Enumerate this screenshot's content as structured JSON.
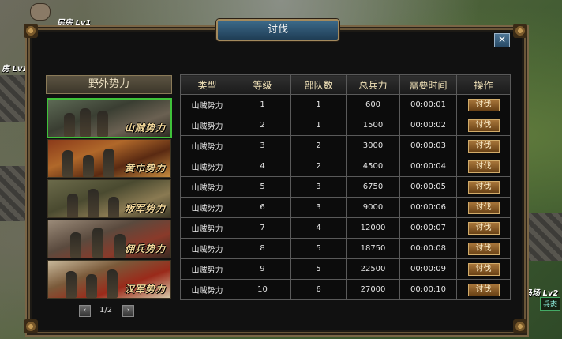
{
  "background": {
    "top_left_label": "民房",
    "top_left_level": "Lv1",
    "left_label": "房",
    "left_level": "Lv1",
    "right_label": "马场",
    "right_level": "Lv2",
    "right_tag": "兵态"
  },
  "dialog": {
    "title": "讨伐",
    "close_label": "✕"
  },
  "sidebar": {
    "header": "野外势力",
    "factions": [
      {
        "name": "山贼势力",
        "selected": true
      },
      {
        "name": "黄巾势力",
        "selected": false
      },
      {
        "name": "叛军势力",
        "selected": false
      },
      {
        "name": "佣兵势力",
        "selected": false
      },
      {
        "name": "汉军势力",
        "selected": false
      }
    ],
    "pager": {
      "prev": "‹",
      "next": "›",
      "text": "1/2"
    }
  },
  "table": {
    "headers": [
      "类型",
      "等级",
      "部队数",
      "总兵力",
      "需要时间",
      "操作"
    ],
    "rows": [
      {
        "type": "山贼势力",
        "level": "1",
        "units": "1",
        "troops": "600",
        "time": "00:00:01",
        "action": "讨伐"
      },
      {
        "type": "山贼势力",
        "level": "2",
        "units": "1",
        "troops": "1500",
        "time": "00:00:02",
        "action": "讨伐"
      },
      {
        "type": "山贼势力",
        "level": "3",
        "units": "2",
        "troops": "3000",
        "time": "00:00:03",
        "action": "讨伐"
      },
      {
        "type": "山贼势力",
        "level": "4",
        "units": "2",
        "troops": "4500",
        "time": "00:00:04",
        "action": "讨伐"
      },
      {
        "type": "山贼势力",
        "level": "5",
        "units": "3",
        "troops": "6750",
        "time": "00:00:05",
        "action": "讨伐"
      },
      {
        "type": "山贼势力",
        "level": "6",
        "units": "3",
        "troops": "9000",
        "time": "00:00:06",
        "action": "讨伐"
      },
      {
        "type": "山贼势力",
        "level": "7",
        "units": "4",
        "troops": "12000",
        "time": "00:00:07",
        "action": "讨伐"
      },
      {
        "type": "山贼势力",
        "level": "8",
        "units": "5",
        "troops": "18750",
        "time": "00:00:08",
        "action": "讨伐"
      },
      {
        "type": "山贼势力",
        "level": "9",
        "units": "5",
        "troops": "22500",
        "time": "00:00:09",
        "action": "讨伐"
      },
      {
        "type": "山贼势力",
        "level": "10",
        "units": "6",
        "troops": "27000",
        "time": "00:00:10",
        "action": "讨伐"
      }
    ]
  },
  "colors": {
    "selected_border": "#3fc23a",
    "button": "#8a5a28",
    "header_text": "#f1e2b8"
  }
}
